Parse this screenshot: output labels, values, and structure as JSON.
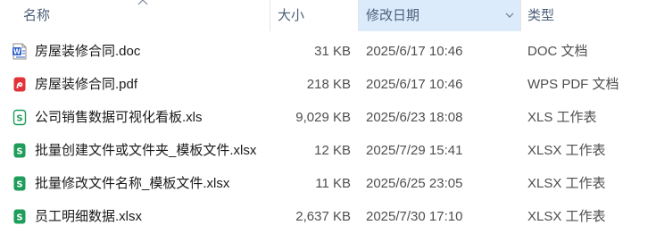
{
  "columns": {
    "name": "名称",
    "size": "大小",
    "date": "修改日期",
    "type": "类型"
  },
  "files": [
    {
      "name": "房屋装修合同.doc",
      "size": "31 KB",
      "date": "2025/6/17 10:46",
      "type": "DOC 文档",
      "icon": "word-doc-icon",
      "icon_color": "#2b5fcb"
    },
    {
      "name": "房屋装修合同.pdf",
      "size": "218 KB",
      "date": "2025/6/17 10:46",
      "type": "WPS PDF 文档",
      "icon": "wps-pdf-icon",
      "icon_color": "#e0333a"
    },
    {
      "name": "公司销售数据可视化看板.xls",
      "size": "9,029 KB",
      "date": "2025/6/23 18:08",
      "type": "XLS 工作表",
      "icon": "spreadsheet-icon",
      "icon_color": "#1f9d5a"
    },
    {
      "name": "批量创建文件或文件夹_模板文件.xlsx",
      "size": "12 KB",
      "date": "2025/7/29 15:41",
      "type": "XLSX 工作表",
      "icon": "spreadsheet-icon",
      "icon_color": "#1f9d5a"
    },
    {
      "name": "批量修改文件名称_模板文件.xlsx",
      "size": "11 KB",
      "date": "2025/6/25 23:05",
      "type": "XLSX 工作表",
      "icon": "spreadsheet-icon",
      "icon_color": "#1f9d5a"
    },
    {
      "name": "员工明细数据.xlsx",
      "size": "2,637 KB",
      "date": "2025/7/30 17:10",
      "type": "XLSX 工作表",
      "icon": "spreadsheet-icon",
      "icon_color": "#1f9d5a"
    }
  ]
}
